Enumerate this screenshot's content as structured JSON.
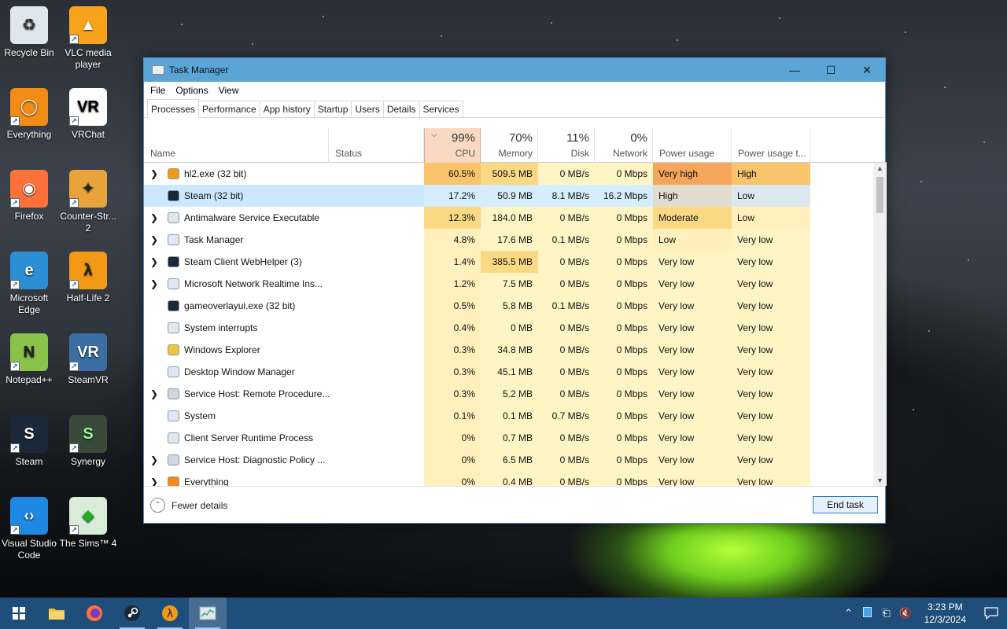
{
  "desktop": {
    "icons": [
      {
        "label": "Recycle Bin",
        "icon": "recycle-bin-icon"
      },
      {
        "label": "VLC media player",
        "icon": "vlc-icon"
      },
      {
        "label": "Everything",
        "icon": "everything-icon"
      },
      {
        "label": "VRChat",
        "icon": "vrchat-icon"
      },
      {
        "label": "Firefox",
        "icon": "firefox-icon"
      },
      {
        "label": "Counter-Str... 2",
        "icon": "counter-strike-icon"
      },
      {
        "label": "Microsoft Edge",
        "icon": "edge-icon"
      },
      {
        "label": "Half-Life 2",
        "icon": "half-life-icon"
      },
      {
        "label": "Notepad++",
        "icon": "notepadpp-icon"
      },
      {
        "label": "SteamVR",
        "icon": "steamvr-icon"
      },
      {
        "label": "Steam",
        "icon": "steam-icon"
      },
      {
        "label": "Synergy",
        "icon": "synergy-icon"
      },
      {
        "label": "Visual Studio Code",
        "icon": "vscode-icon"
      },
      {
        "label": "The Sims™ 4",
        "icon": "sims-icon"
      }
    ]
  },
  "window": {
    "title": "Task Manager",
    "menu": [
      "File",
      "Options",
      "View"
    ],
    "tabs": [
      "Processes",
      "Performance",
      "App history",
      "Startup",
      "Users",
      "Details",
      "Services"
    ],
    "active_tab": "Processes"
  },
  "columns": {
    "name": "Name",
    "status": "Status",
    "cpu": {
      "pct": "99%",
      "label": "CPU"
    },
    "memory": {
      "pct": "70%",
      "label": "Memory"
    },
    "disk": {
      "pct": "11%",
      "label": "Disk"
    },
    "network": {
      "pct": "0%",
      "label": "Network"
    },
    "power": "Power usage",
    "power_trend": "Power usage t..."
  },
  "processes": [
    {
      "name": "hl2.exe (32 bit)",
      "expandable": true,
      "icon": "half-life-icon",
      "cpu": "60.5%",
      "memory": "509.5 MB",
      "disk": "0 MB/s",
      "network": "0 Mbps",
      "power": "Very high",
      "power_trend": "High"
    },
    {
      "name": "Steam (32 bit)",
      "expandable": false,
      "icon": "steam-icon",
      "cpu": "17.2%",
      "memory": "50.9 MB",
      "disk": "8.1 MB/s",
      "network": "16.2 Mbps",
      "power": "High",
      "power_trend": "Low",
      "selected": true
    },
    {
      "name": "Antimalware Service Executable",
      "expandable": true,
      "icon": "window-icon",
      "cpu": "12.3%",
      "memory": "184.0 MB",
      "disk": "0 MB/s",
      "network": "0 Mbps",
      "power": "Moderate",
      "power_trend": "Low"
    },
    {
      "name": "Task Manager",
      "expandable": true,
      "icon": "task-manager-icon",
      "cpu": "4.8%",
      "memory": "17.6 MB",
      "disk": "0.1 MB/s",
      "network": "0 Mbps",
      "power": "Low",
      "power_trend": "Very low"
    },
    {
      "name": "Steam Client WebHelper (3)",
      "expandable": true,
      "icon": "steam-icon",
      "cpu": "1.4%",
      "memory": "385.5 MB",
      "disk": "0 MB/s",
      "network": "0 Mbps",
      "power": "Very low",
      "power_trend": "Very low"
    },
    {
      "name": "Microsoft Network Realtime Ins...",
      "expandable": true,
      "icon": "window-icon",
      "cpu": "1.2%",
      "memory": "7.5 MB",
      "disk": "0 MB/s",
      "network": "0 Mbps",
      "power": "Very low",
      "power_trend": "Very low"
    },
    {
      "name": "gameoverlayui.exe (32 bit)",
      "expandable": false,
      "icon": "steam-icon",
      "cpu": "0.5%",
      "memory": "5.8 MB",
      "disk": "0.1 MB/s",
      "network": "0 Mbps",
      "power": "Very low",
      "power_trend": "Very low"
    },
    {
      "name": "System interrupts",
      "expandable": false,
      "icon": "window-icon",
      "cpu": "0.4%",
      "memory": "0 MB",
      "disk": "0 MB/s",
      "network": "0 Mbps",
      "power": "Very low",
      "power_trend": "Very low"
    },
    {
      "name": "Windows Explorer",
      "expandable": false,
      "icon": "folder-icon",
      "cpu": "0.3%",
      "memory": "34.8 MB",
      "disk": "0 MB/s",
      "network": "0 Mbps",
      "power": "Very low",
      "power_trend": "Very low"
    },
    {
      "name": "Desktop Window Manager",
      "expandable": false,
      "icon": "window-icon",
      "cpu": "0.3%",
      "memory": "45.1 MB",
      "disk": "0 MB/s",
      "network": "0 Mbps",
      "power": "Very low",
      "power_trend": "Very low"
    },
    {
      "name": "Service Host: Remote Procedure...",
      "expandable": true,
      "icon": "gear-icon",
      "cpu": "0.3%",
      "memory": "5.2 MB",
      "disk": "0 MB/s",
      "network": "0 Mbps",
      "power": "Very low",
      "power_trend": "Very low"
    },
    {
      "name": "System",
      "expandable": false,
      "icon": "window-icon",
      "cpu": "0.1%",
      "memory": "0.1 MB",
      "disk": "0.7 MB/s",
      "network": "0 Mbps",
      "power": "Very low",
      "power_trend": "Very low"
    },
    {
      "name": "Client Server Runtime Process",
      "expandable": false,
      "icon": "window-icon",
      "cpu": "0%",
      "memory": "0.7 MB",
      "disk": "0 MB/s",
      "network": "0 Mbps",
      "power": "Very low",
      "power_trend": "Very low"
    },
    {
      "name": "Service Host: Diagnostic Policy ...",
      "expandable": true,
      "icon": "gear-icon",
      "cpu": "0%",
      "memory": "6.5 MB",
      "disk": "0 MB/s",
      "network": "0 Mbps",
      "power": "Very low",
      "power_trend": "Very low"
    },
    {
      "name": "Everything",
      "expandable": true,
      "icon": "everything-icon",
      "cpu": "0%",
      "memory": "0.4 MB",
      "disk": "0 MB/s",
      "network": "0 Mbps",
      "power": "Very low",
      "power_trend": "Very low"
    }
  ],
  "footer": {
    "fewer_details": "Fewer details",
    "end_task": "End task"
  },
  "taskbar": {
    "apps": [
      "start-icon",
      "file-explorer-icon",
      "firefox-icon",
      "steam-icon",
      "half-life-icon",
      "task-manager-icon"
    ],
    "time": "3:23 PM",
    "date": "12/3/2024"
  },
  "colors": {
    "cpu_header": "#f9d9c3",
    "very_high": "#f5a65b",
    "high": "#f9c46a",
    "moderate": "#fbd984",
    "low_cell": "#fff0be",
    "cell": "#fff4c4",
    "selected_row": "#cce8ff",
    "taskbar": "#1f4e7a",
    "titlebar": "#5aa5d6"
  }
}
